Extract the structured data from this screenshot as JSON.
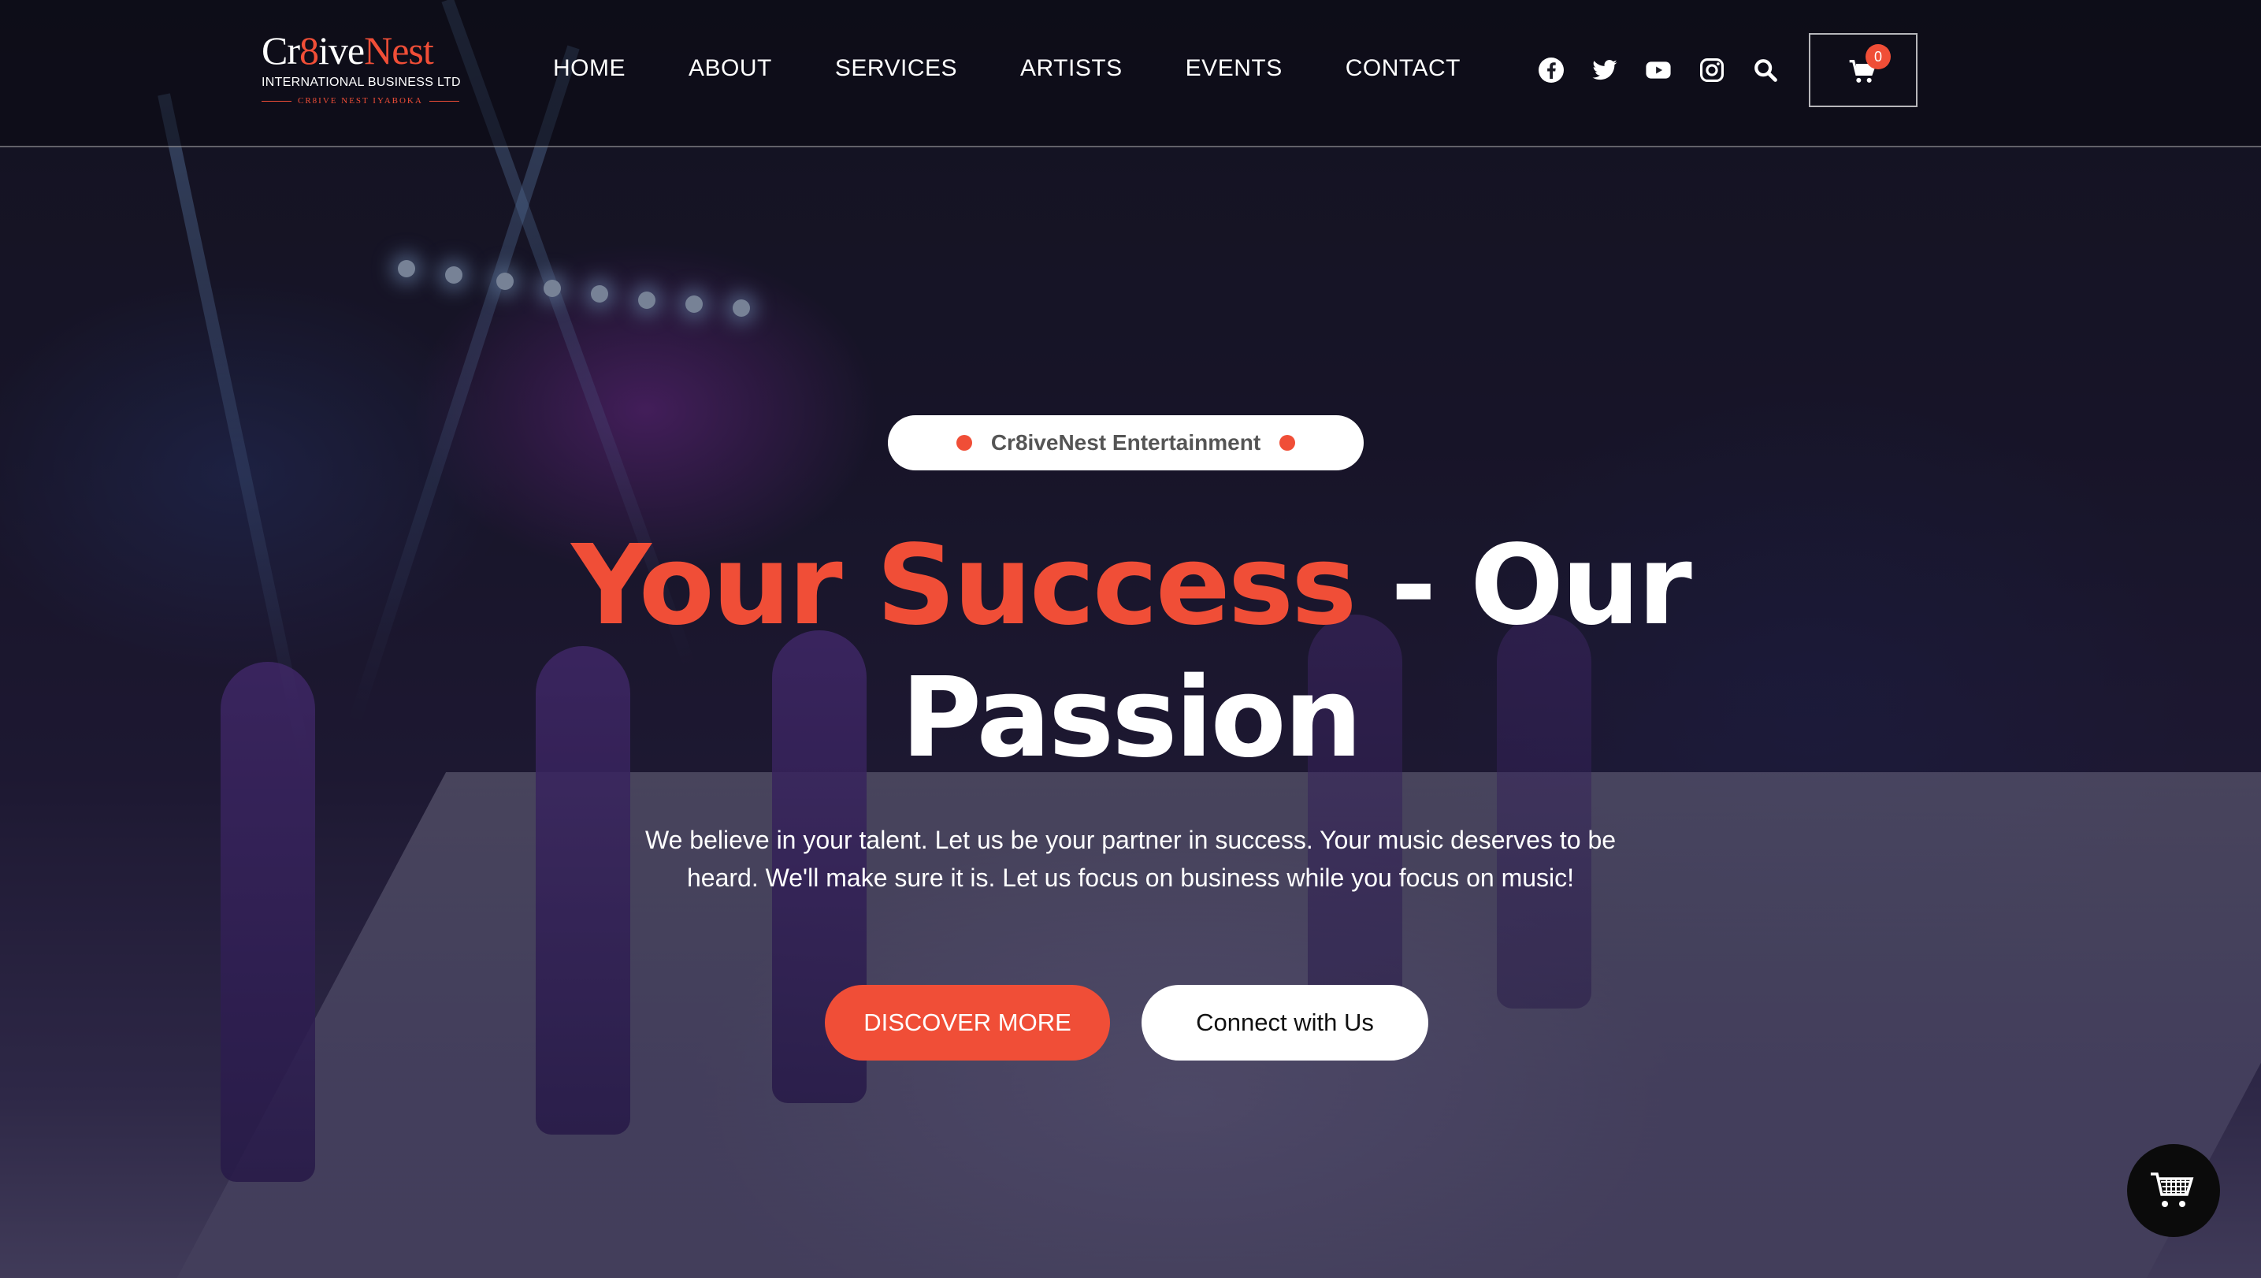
{
  "logo": {
    "name_part1": "Cr",
    "name_digit": "8",
    "name_part2": "ive",
    "name_part3": "Nest",
    "subtitle": "INTERNATIONAL BUSINESS LTD",
    "tagline": "CR8IVE NEST IYABOKA"
  },
  "nav": {
    "items": [
      {
        "label": "HOME"
      },
      {
        "label": "ABOUT"
      },
      {
        "label": "SERVICES"
      },
      {
        "label": "ARTISTS"
      },
      {
        "label": "EVENTS"
      },
      {
        "label": "CONTACT"
      }
    ]
  },
  "social_icons": [
    "facebook-icon",
    "twitter-icon",
    "youtube-icon",
    "instagram-icon",
    "search-icon"
  ],
  "cart": {
    "count": "0"
  },
  "hero": {
    "pill_label": "Cr8iveNest Entertainment",
    "headline_accent": "Your Success",
    "headline_rest": " - Our Passion",
    "description": "We believe in your talent. Let us be your partner in success. Your music deserves to be heard. We'll make sure it is. Let us focus on business while you focus on music!",
    "primary_button": "DISCOVER MORE",
    "secondary_button": "Connect with Us"
  },
  "colors": {
    "accent": "#f04e37",
    "header_bg": "#0a0a12",
    "white": "#ffffff"
  }
}
